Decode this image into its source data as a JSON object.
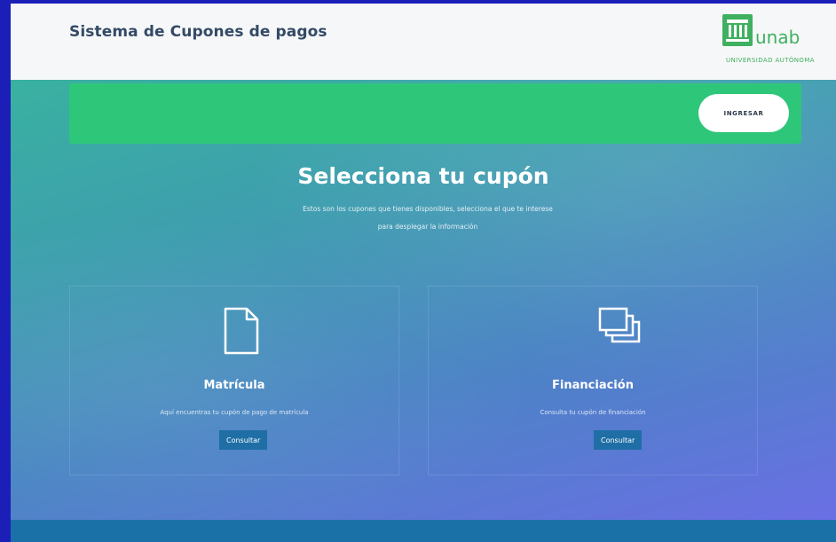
{
  "header": {
    "title": "Sistema de Cupones de pagos",
    "logo_text": "unab",
    "logo_subtext": "UNIVERSIDAD AUTÓNOMA"
  },
  "topbar": {
    "button_label": "INGRESAR",
    "bar_color": "#2ec77a"
  },
  "hero": {
    "title": "Selecciona tu cupón",
    "description_line1": "Estos son los cupones que tienes disponibles, selecciona el que te interese",
    "description_line2": "para desplegar la información"
  },
  "cards": [
    {
      "icon": "document-icon",
      "title": "Matrícula",
      "text": "Aquí encuentras tu cupón de pago de matrícula",
      "button_label": "Consultar"
    },
    {
      "icon": "copy-icon",
      "title": "Financiación",
      "text": "Consulta tu cupón de financiación",
      "button_label": "Consultar"
    }
  ],
  "colors": {
    "accent_green": "#2ec77a",
    "button_blue": "#1f6fa6",
    "footer_blue": "#1a71a8",
    "frame_blue": "#1b1fb8"
  }
}
